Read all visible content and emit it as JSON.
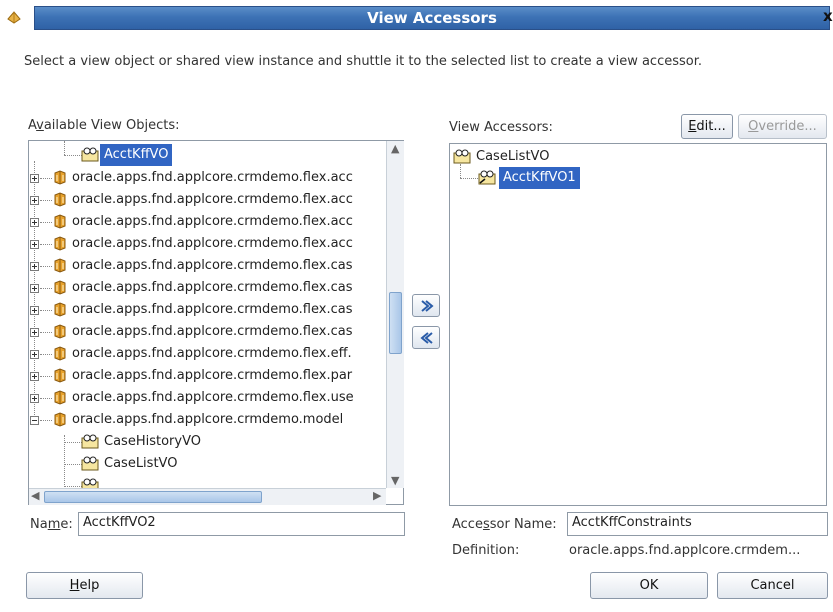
{
  "window": {
    "title": "View Accessors",
    "close_glyph": "x"
  },
  "instruction": "Select a view object or shared view instance and shuttle it to the selected list to create a view accessor.",
  "available": {
    "label_pre": "A",
    "label_mnemonic": "v",
    "label_post": "ailable View Objects:",
    "items": [
      {
        "text": "AcctKffVO",
        "kind": "vo",
        "selected": true
      },
      {
        "text": "oracle.apps.fnd.applcore.crmdemo.flex.acc",
        "kind": "pkg"
      },
      {
        "text": "oracle.apps.fnd.applcore.crmdemo.flex.acc",
        "kind": "pkg"
      },
      {
        "text": "oracle.apps.fnd.applcore.crmdemo.flex.acc",
        "kind": "pkg"
      },
      {
        "text": "oracle.apps.fnd.applcore.crmdemo.flex.acc",
        "kind": "pkg"
      },
      {
        "text": "oracle.apps.fnd.applcore.crmdemo.flex.cas",
        "kind": "pkg"
      },
      {
        "text": "oracle.apps.fnd.applcore.crmdemo.flex.cas",
        "kind": "pkg"
      },
      {
        "text": "oracle.apps.fnd.applcore.crmdemo.flex.cas",
        "kind": "pkg"
      },
      {
        "text": "oracle.apps.fnd.applcore.crmdemo.flex.cas",
        "kind": "pkg"
      },
      {
        "text": "oracle.apps.fnd.applcore.crmdemo.flex.eff.",
        "kind": "pkg"
      },
      {
        "text": "oracle.apps.fnd.applcore.crmdemo.flex.par",
        "kind": "pkg"
      },
      {
        "text": "oracle.apps.fnd.applcore.crmdemo.flex.use",
        "kind": "pkg"
      },
      {
        "text": "oracle.apps.fnd.applcore.crmdemo.model",
        "kind": "pkg-open"
      },
      {
        "text": "CaseHistoryVO",
        "kind": "vo"
      },
      {
        "text": "CaseListVO",
        "kind": "vo"
      }
    ]
  },
  "accessors": {
    "label": "View Accessors:",
    "edit_pre": "",
    "edit_mnemonic": "E",
    "edit_post": "dit...",
    "override_pre": "",
    "override_mnemonic": "O",
    "override_post": "verride...",
    "root": "CaseListVO",
    "child": "AcctKffVO1"
  },
  "shuttle": {
    "add_icon": "shuttle-right-icon",
    "remove_icon": "shuttle-left-icon"
  },
  "name_field": {
    "label_pre": "Na",
    "label_mnemonic": "m",
    "label_post": "e:",
    "value": "AcctKffVO2"
  },
  "accessor_name": {
    "label_pre": "Acce",
    "label_mnemonic": "s",
    "label_post": "sor Name:",
    "value": "AcctKffConstraints"
  },
  "definition": {
    "label": "Definition:",
    "value": "oracle.apps.fnd.applcore.crmdem..."
  },
  "buttons": {
    "help_pre": "",
    "help_mnemonic": "H",
    "help_post": "elp",
    "ok": "OK",
    "cancel": "Cancel"
  },
  "colors": {
    "title_blue": "#3d72b5",
    "selection_blue": "#3165c3"
  }
}
